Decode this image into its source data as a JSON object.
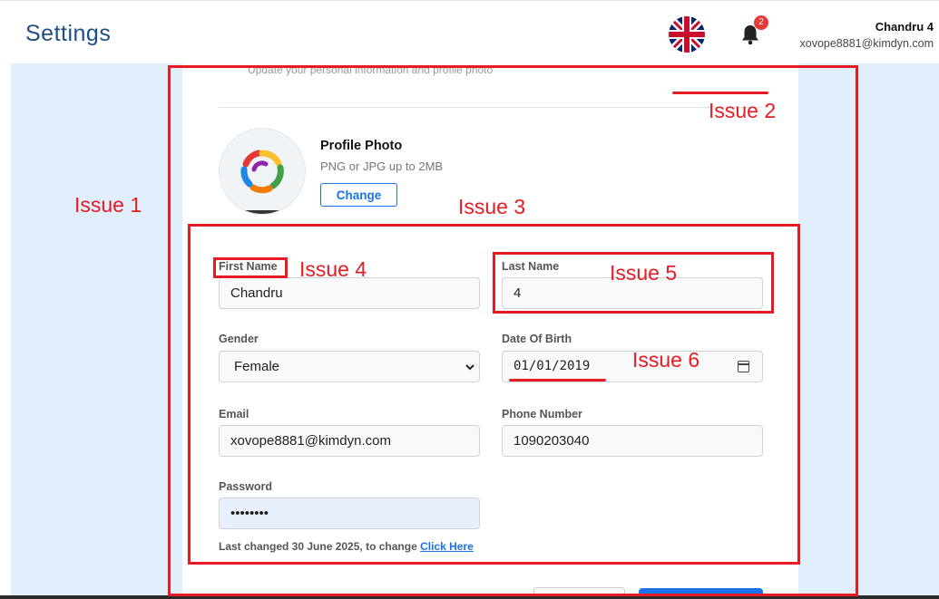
{
  "header": {
    "title": "Settings",
    "user_name": "Chandru 4",
    "user_email": "xovope8881@kimdyn.com",
    "notification_count": "2",
    "language_icon": "uk-flag-icon",
    "bell_icon": "bell-icon"
  },
  "profile": {
    "subtitle": "Update your personal information and profile photo",
    "photo_title": "Profile Photo",
    "photo_hint": "PNG or JPG up to 2MB",
    "change_label": "Change"
  },
  "form": {
    "first_name": {
      "label": "First Name",
      "value": "Chandru"
    },
    "last_name": {
      "label": "Last Name",
      "value": "4"
    },
    "gender": {
      "label": "Gender",
      "value": "Female"
    },
    "dob": {
      "label": "Date Of Birth",
      "value": "01/01/2019"
    },
    "email": {
      "label": "Email",
      "value": "xovope8881@kimdyn.com"
    },
    "phone": {
      "label": "Phone Number",
      "value": "1090203040"
    },
    "password": {
      "label": "Password",
      "value": "••••••••"
    },
    "password_note": "Last changed 30 June 2025, to change",
    "password_link": "Click Here"
  },
  "annotations": {
    "issue1": "Issue 1",
    "issue2": "Issue 2",
    "issue3": "Issue 3",
    "issue4": "Issue 4",
    "issue5": "Issue 5",
    "issue6": "Issue 6"
  },
  "colors": {
    "accent": "#1a73e8",
    "heading": "#1d4f82",
    "annotation": "#e51c23",
    "page_bg": "#e1eefb"
  }
}
